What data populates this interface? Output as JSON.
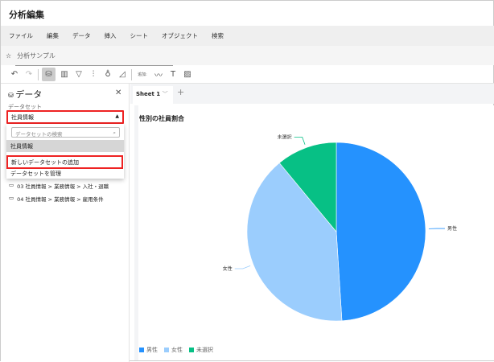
{
  "app": {
    "title": "分析編集"
  },
  "menu": [
    "ファイル",
    "編集",
    "データ",
    "挿入",
    "シート",
    "オブジェクト",
    "検索"
  ],
  "breadcrumb": {
    "name": "分析サンプル"
  },
  "toolbar": {
    "add_label": "追加:"
  },
  "panel": {
    "title": "データ",
    "dataset_label": "データセット",
    "selected": "社員情報",
    "search_placeholder": "データセットの検索",
    "options": [
      "社員情報",
      "新しいデータセットの追加",
      "データセットを管理"
    ],
    "folders": [
      "03 社員情報 > 業務情報 > 入社・退職",
      "04 社員情報 > 業務情報 > 雇用条件"
    ]
  },
  "sheet": {
    "tab": "Sheet 1"
  },
  "colors": {
    "male": "#2592fe",
    "female": "#9bcdfd",
    "unselected": "#07c085",
    "highlight": "#e22222"
  },
  "chart_data": {
    "type": "pie",
    "title": "性別の社員割合",
    "categories": [
      "男性",
      "女性",
      "未選択"
    ],
    "values": [
      49,
      40,
      11
    ],
    "legend": "bottom-left"
  }
}
